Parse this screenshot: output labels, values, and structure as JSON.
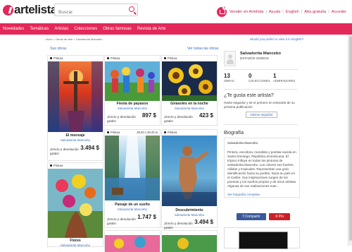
{
  "header": {
    "logo_text": "artelista",
    "search_placeholder": "Buscar",
    "cart_count": "0",
    "links": [
      "Vender en Artelista",
      "Ayuda",
      "English",
      "Alta gratuita",
      "Acceder"
    ]
  },
  "nav": [
    "Novedades",
    "Temáticas",
    "Artistas",
    "Colecciones",
    "Obras famosas",
    "Revista de Arte"
  ],
  "breadcrumb": "Inicio > Obras de arte > Salvadorita Mancebo",
  "english_link": "Would you prefer to view it in English?",
  "gallery": {
    "heading": "Sus obras",
    "see_all": "Ver todas las obras",
    "type_label": "Pintura",
    "shipping": "¡Envío y devolución gratis!",
    "items": [
      {
        "title": "El mensaje",
        "artist": "Salvadorita Mancebo",
        "price": "3.494 $",
        "dims": ""
      },
      {
        "title": "Fiesta de payasos",
        "artist": "Salvadorita Mancebo",
        "price": "897 $",
        "dims": ""
      },
      {
        "title": "Girasoles en la noche",
        "artist": "Salvadorita Mancebo",
        "price": "423 $",
        "dims": ""
      },
      {
        "title": "Flores",
        "artist": "Salvadorita Mancebo",
        "price": "",
        "dims": ""
      },
      {
        "title": "Paisaje de un sueño",
        "artist": "Salvadorita Mancebo",
        "price": "1.747 $",
        "dims": "29.20 x 28.20 in"
      },
      {
        "title": "Descubrimiento",
        "artist": "Salvadorita Mancebo",
        "price": "3.494 $",
        "dims": ""
      }
    ]
  },
  "artist": {
    "name": "Salvadorita Mancebo",
    "country": "ESTADOS UNIDOS",
    "stats": [
      {
        "num": "13",
        "label": "OBRAS"
      },
      {
        "num": "0",
        "label": "COLECCIONES"
      },
      {
        "num": "1",
        "label": "ADMIRADORES"
      }
    ],
    "like_heading": "¿Te gusta este artista?",
    "like_text": "Hazte seguidor y sé el primero en enterarte de su próxima publicación",
    "follow_label": "Hazme seguidor",
    "bio_heading": "Biografía",
    "bio_title": "Salvadorita Mancebo",
    "bio_body": "Pintora, escultora, muralista y poetisa nacida en Santo Domingo, República Dominicana. El trópico influye en todas las pinturas de Salvadorita Mancebo. Los colores son fuertes, cálidos y tropicales. Representan una gran identificación hacia su pueblo, hacia su país en el Caribe. Sus inspiraciones surgen de los poemas y los sueños propios y de otros artistas. Algunas de sus realizaciones mas...",
    "bio_more": "Ver biografía completa",
    "share_fb": "Compartir",
    "share_pin": "Pin"
  }
}
